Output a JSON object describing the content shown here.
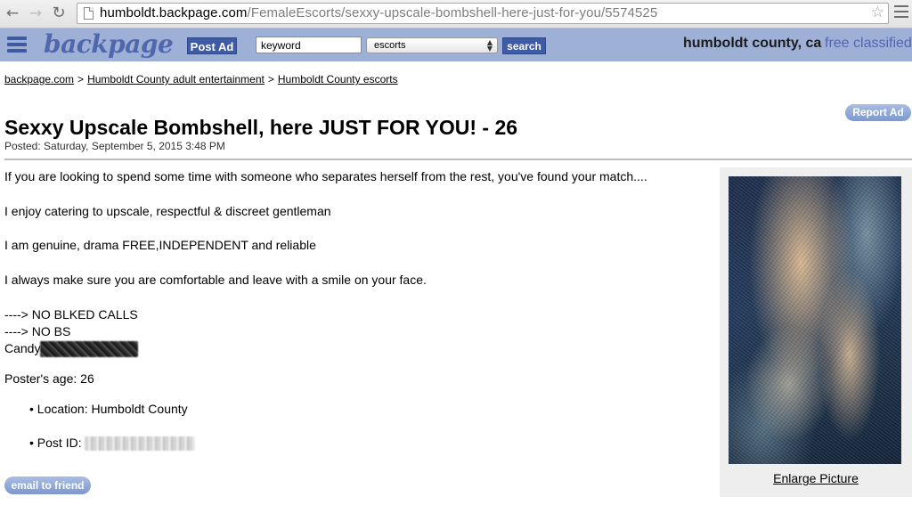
{
  "browser": {
    "url_host": "humboldt.backpage.com",
    "url_path": "/FemaleEscorts/sexxy-upscale-bombshell-here-just-for-you/5574525",
    "back_icon": "arrow-left",
    "forward_icon": "arrow-right",
    "reload_icon": "reload",
    "star_icon": "star-outline",
    "menu_icon": "hamburger-menu"
  },
  "header": {
    "logo": "backpage",
    "post_ad_label": "Post Ad",
    "keyword_value": "keyword",
    "category_selected": "escorts",
    "search_label": "search",
    "location": "humboldt county, ca",
    "tagline": "free classifieds",
    "brand_color": "#4f67ad",
    "bar_color": "#9fb0d6"
  },
  "breadcrumb": {
    "items": [
      "backpage.com",
      "Humboldt County adult entertainment",
      "Humboldt County escorts"
    ],
    "separator": ">"
  },
  "ad": {
    "report_label": "Report Ad",
    "title": "Sexxy Upscale Bombshell, here JUST FOR YOU! - 26",
    "posted": "Posted: Saturday, September 5, 2015 3:48 PM",
    "body": [
      "If you are looking to spend some time with someone who separates herself from the rest, you've found your match....",
      "I enjoy catering to upscale, respectful & discreet gentleman",
      "I am genuine, drama FREE,INDEPENDENT and reliable",
      "I always make sure you are comfortable and leave with a smile on your face.",
      "----> NO BLKED CALLS",
      "----> NO BS",
      "Candy"
    ],
    "posters_age": "Poster's age: 26",
    "location": "• Location: Humboldt County",
    "post_id_label": "• Post ID:",
    "email_label": "email to friend",
    "enlarge_label": "Enlarge Picture"
  }
}
